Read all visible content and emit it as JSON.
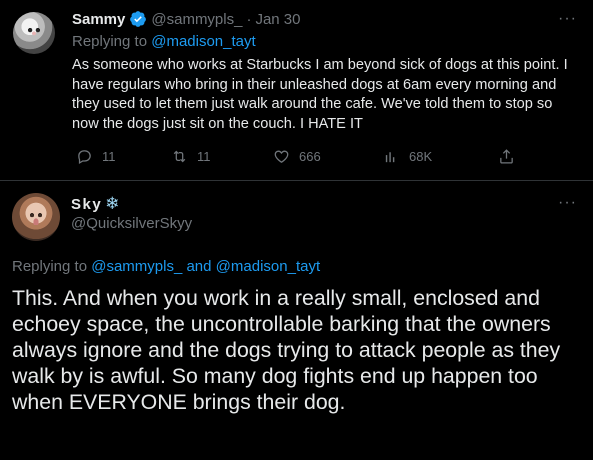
{
  "reply": {
    "name": "Sammy",
    "handle": "@sammypls_",
    "dot": "·",
    "date": "Jan 30",
    "replying_prefix": "Replying to ",
    "replying_to": "@madison_tayt",
    "text": "As someone who works at Starbucks I am beyond sick of dogs at this point. I have regulars who bring in their unleashed dogs at 6am every morning and they used to let them just walk around the cafe. We've told them to stop so now the dogs just sit on the couch. I HATE IT",
    "actions": {
      "replies": "11",
      "retweets": "11",
      "likes": "666",
      "views": "68K"
    },
    "more": "···"
  },
  "tweet": {
    "name": "Sky",
    "name_emoji": "❄",
    "handle": "@QuicksilverSkyy",
    "replying_prefix": "Replying to ",
    "replying_to_1": "@sammypls_",
    "replying_and": " and ",
    "replying_to_2": "@madison_tayt",
    "text": "This. And when you work in a really small, enclosed and echoey space, the uncontrollable barking that the owners always ignore and the dogs trying to attack people as they walk by is awful. So many dog fights end up happen too when EVERYONE brings their dog.",
    "more": "···"
  },
  "colors": {
    "background": "#000000",
    "text": "#e7e9ea",
    "muted": "#71767b",
    "link": "#1d9bf0",
    "divider": "#2f3336"
  },
  "icons": {
    "verified": "verified-badge-icon",
    "reply": "reply-icon",
    "retweet": "retweet-icon",
    "like": "heart-icon",
    "views": "views-icon",
    "share": "share-icon",
    "more": "more-icon"
  }
}
